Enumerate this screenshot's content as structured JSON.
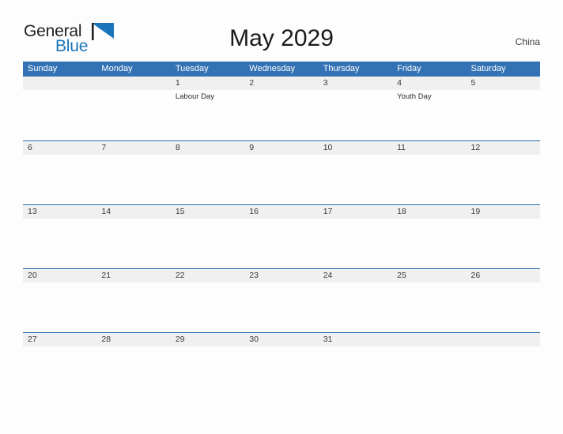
{
  "brand": {
    "word_one": "General",
    "word_two": "Blue",
    "flag_icon": "blue-triangle-flag-icon",
    "color_dark": "#231f20",
    "color_blue": "#1b75bb"
  },
  "header": {
    "title": "May 2029",
    "country": "China"
  },
  "colors": {
    "header_blue": "#3372b4",
    "row_divider_blue": "#2b6cad",
    "date_band_gray": "#f0f0f0",
    "page_background": "#fdfdfd",
    "text_dark": "#1a1a1a"
  },
  "calendar": {
    "weekdays": [
      "Sunday",
      "Monday",
      "Tuesday",
      "Wednesday",
      "Thursday",
      "Friday",
      "Saturday"
    ],
    "weeks": [
      {
        "days": [
          {
            "date": "",
            "event": ""
          },
          {
            "date": "",
            "event": ""
          },
          {
            "date": "1",
            "event": "Labour Day"
          },
          {
            "date": "2",
            "event": ""
          },
          {
            "date": "3",
            "event": ""
          },
          {
            "date": "4",
            "event": "Youth Day"
          },
          {
            "date": "5",
            "event": ""
          }
        ]
      },
      {
        "days": [
          {
            "date": "6",
            "event": ""
          },
          {
            "date": "7",
            "event": ""
          },
          {
            "date": "8",
            "event": ""
          },
          {
            "date": "9",
            "event": ""
          },
          {
            "date": "10",
            "event": ""
          },
          {
            "date": "11",
            "event": ""
          },
          {
            "date": "12",
            "event": ""
          }
        ]
      },
      {
        "days": [
          {
            "date": "13",
            "event": ""
          },
          {
            "date": "14",
            "event": ""
          },
          {
            "date": "15",
            "event": ""
          },
          {
            "date": "16",
            "event": ""
          },
          {
            "date": "17",
            "event": ""
          },
          {
            "date": "18",
            "event": ""
          },
          {
            "date": "19",
            "event": ""
          }
        ]
      },
      {
        "days": [
          {
            "date": "20",
            "event": ""
          },
          {
            "date": "21",
            "event": ""
          },
          {
            "date": "22",
            "event": ""
          },
          {
            "date": "23",
            "event": ""
          },
          {
            "date": "24",
            "event": ""
          },
          {
            "date": "25",
            "event": ""
          },
          {
            "date": "26",
            "event": ""
          }
        ]
      },
      {
        "days": [
          {
            "date": "27",
            "event": ""
          },
          {
            "date": "28",
            "event": ""
          },
          {
            "date": "29",
            "event": ""
          },
          {
            "date": "30",
            "event": ""
          },
          {
            "date": "31",
            "event": ""
          },
          {
            "date": "",
            "event": ""
          },
          {
            "date": "",
            "event": ""
          }
        ]
      }
    ]
  }
}
